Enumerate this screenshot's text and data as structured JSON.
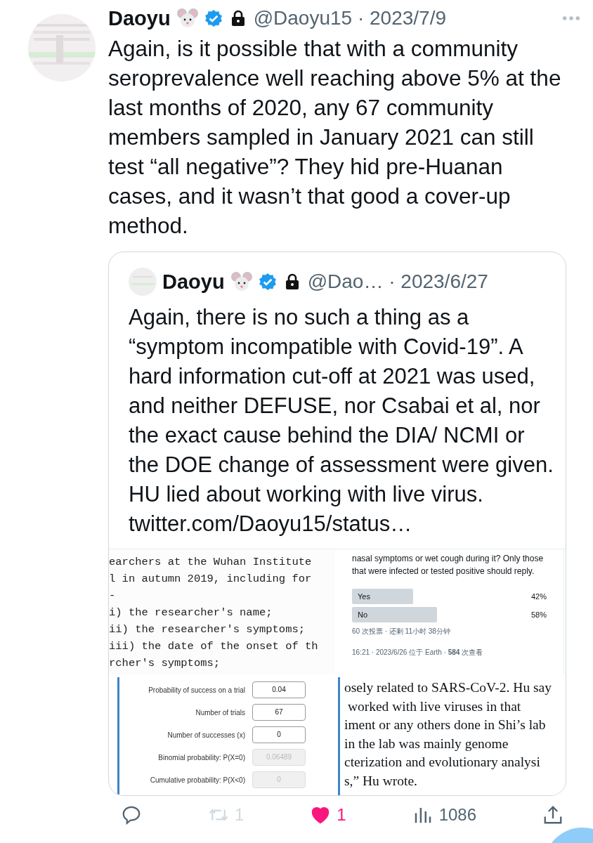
{
  "tweet": {
    "author": "Daoyu",
    "handle_date": "@Daoyu15 · 2023/7/9",
    "text": "Again, is it possible that with a community seroprevalence well reaching above 5% at the last months of 2020, any 67 community members sampled in January 2021 can still test “all negative”? They hid pre-Huanan cases, and it wasn’t that good a cover-up method."
  },
  "quote": {
    "author": "Daoyu",
    "handle_date": "@Dao… · 2023/6/27",
    "text": "Again, there is no such a thing as a “symptom incompatible with Covid-19”. A hard information cut-off at 2021 was used, and neither DEFUSE, nor Csabai et al, nor the exact cause behind the DIA/ NCMI or the DOE change of assessment were given. HU lied about working with live virus. twitter.com/Daoyu15/status…",
    "code_lines": [
      "earchers at the Wuhan Institute",
      "l in autumn 2019, including for",
      "-",
      "i) the researcher's name;",
      "ii) the researcher's symptoms;",
      "iii) the date of the onset of th",
      "rcher's symptoms;"
    ],
    "poll": {
      "question": "nasal symptoms or wet cough during it? Only those that were infected or tested positive should reply.",
      "options": [
        {
          "label": "Yes",
          "percent": "42%"
        },
        {
          "label": "No",
          "percent": "58%"
        }
      ],
      "footer": "60 次投票 · 还剩 11小时 38分钟",
      "meta": "16:21 · 2023/6/26 位于 Earth · **584** 次查看"
    },
    "calculator": [
      {
        "label": "Probability of success on a trial",
        "value": "0.04",
        "disabled": false
      },
      {
        "label": "Number of trials",
        "value": "67",
        "disabled": false
      },
      {
        "label": "Number of successes (x)",
        "value": "0",
        "disabled": false
      },
      {
        "label": "Binomial probability: P(X=0)",
        "value": "0.06489",
        "disabled": true
      },
      {
        "label": "Cumulative probability: P(X<0)",
        "value": "0",
        "disabled": true
      }
    ],
    "article_lines": [
      "osely related to SARS-CoV-2. Hu say",
      " worked with live viruses in that",
      "iment or any others done in Shi’s lab",
      "in the lab was mainly genome",
      "cterization and evolutionary analysi",
      "s,” Hu wrote."
    ]
  },
  "actions": [
    {
      "kind": "reply"
    },
    {
      "kind": "retweet",
      "count": "1",
      "disabled": true
    },
    {
      "kind": "like",
      "count": "1",
      "liked": true
    },
    {
      "kind": "views",
      "count": "1086"
    },
    {
      "kind": "share"
    }
  ]
}
